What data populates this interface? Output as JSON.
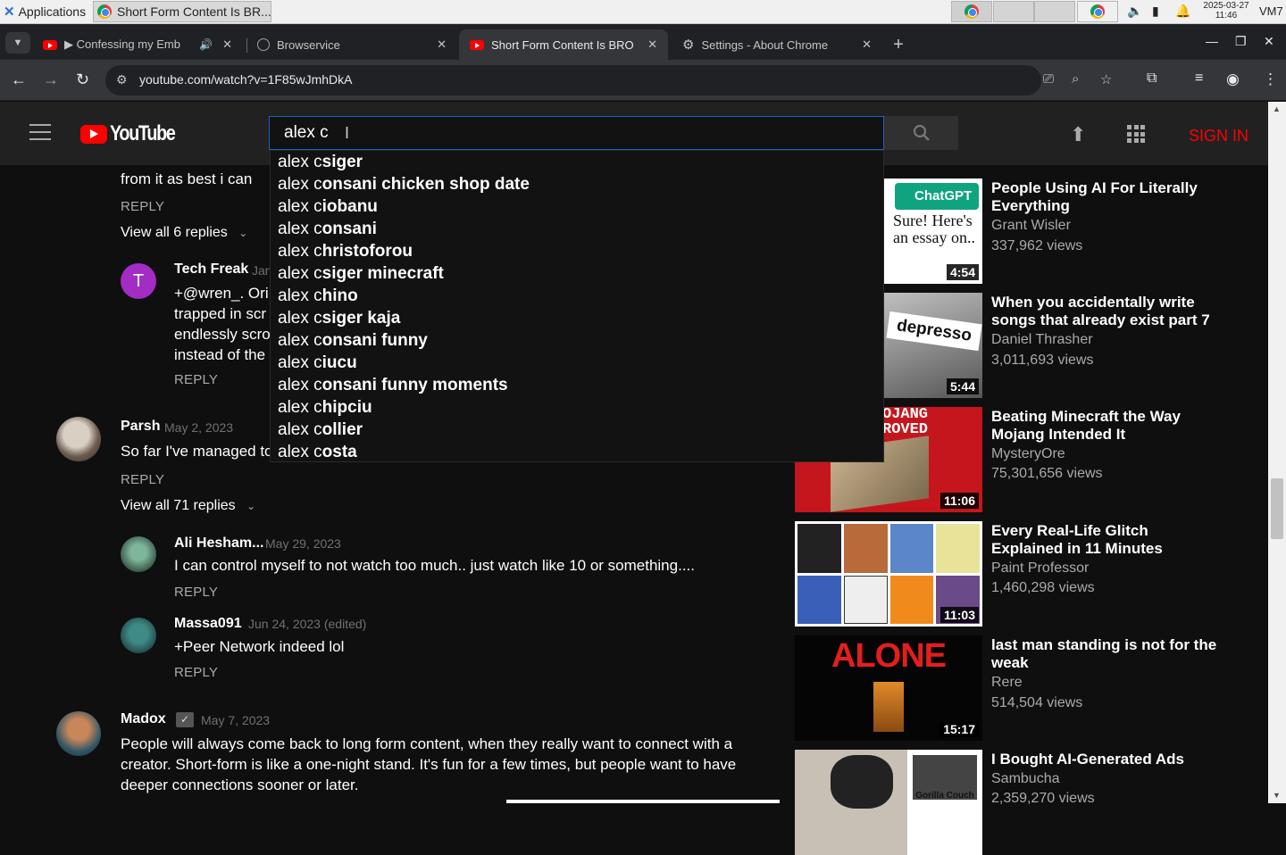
{
  "os": {
    "applications_label": "Applications",
    "task_title": "Short Form Content Is BR...",
    "clock_date": "2025-03-27",
    "clock_time": "11:46",
    "vm_label": "VM7"
  },
  "browser": {
    "tabs": [
      {
        "label": "▶ Confessing my Emba"
      },
      {
        "label": "Browservice"
      },
      {
        "label": "Short Form Content Is BRO"
      },
      {
        "label": "Settings - About Chrome"
      }
    ],
    "url": "youtube.com/watch?v=1F85wJmhDkA"
  },
  "youtube": {
    "logo_text": "YouTube",
    "search_value": "alex c",
    "sign_in": "SIGN IN",
    "suggestions": [
      {
        "prefix": "alex c",
        "rest": "siger"
      },
      {
        "prefix": "alex c",
        "rest": "onsani chicken shop date"
      },
      {
        "prefix": "alex c",
        "rest": "iobanu"
      },
      {
        "prefix": "alex c",
        "rest": "onsani"
      },
      {
        "prefix": "alex c",
        "rest": "hristoforou"
      },
      {
        "prefix": "alex c",
        "rest": "siger minecraft"
      },
      {
        "prefix": "alex c",
        "rest": "hino"
      },
      {
        "prefix": "alex c",
        "rest": "siger kaja"
      },
      {
        "prefix": "alex c",
        "rest": "onsani funny"
      },
      {
        "prefix": "alex c",
        "rest": "iucu"
      },
      {
        "prefix": "alex c",
        "rest": "onsani funny moments"
      },
      {
        "prefix": "alex c",
        "rest": "hipciu"
      },
      {
        "prefix": "alex c",
        "rest": "ollier"
      },
      {
        "prefix": "alex c",
        "rest": "osta"
      }
    ]
  },
  "comments": {
    "reply_label": "REPLY",
    "partial_line": "from it as best i can",
    "view_all_1": "View all 6 replies",
    "techfreak": {
      "initial": "T",
      "author": "Tech Freak",
      "date": "Jan",
      "lines": [
        "+@wren_. Ori",
        "trapped in scr",
        "endlessly scro",
        "instead of the"
      ]
    },
    "parsh": {
      "author": "Parsh",
      "date": "May 2, 2023",
      "text": "So far I've managed to"
    },
    "view_all_2": "View all 71 replies",
    "ali": {
      "author": "Ali Hesham...",
      "date": "May 29, 2023",
      "text": "I can control myself to not watch too much.. just watch like 10 or something...."
    },
    "massa": {
      "author": "Massa091",
      "date": "Jun 24, 2023 (edited)",
      "text": "+Peer Network indeed lol"
    },
    "madox": {
      "author": "Madox",
      "date": "May 7, 2023",
      "lines": [
        "People will always come back to long form content, when they really want to connect with a",
        "creator. Short-form is like a one-night stand. It's fun for a few times, but people want to have",
        "deeper connections sooner or later."
      ]
    }
  },
  "related": [
    {
      "title": "People Using AI For Literally Everything",
      "channel": "Grant Wisler",
      "views": "337,962 views",
      "duration": "4:54",
      "thumb_text": "Sure! Here's an essay on..",
      "thumb_badge": "ChatGPT"
    },
    {
      "title": "When you accidentally write songs that already exist part 7",
      "channel": "Daniel Thrasher",
      "views": "3,011,693 views",
      "duration": "5:44",
      "thumb_text": "depresso"
    },
    {
      "title": "Beating Minecraft the Way Mojang Intended It",
      "channel": "MysteryOre",
      "views": "75,301,656 views",
      "duration": "11:06",
      "thumb_text": "OJANG ROVED"
    },
    {
      "title": "Every Real-Life Glitch Explained in 11 Minutes",
      "channel": "Paint Professor",
      "views": "1,460,298 views",
      "duration": "11:03"
    },
    {
      "title": "last man standing is not for the weak",
      "channel": "Rere",
      "views": "514,504 views",
      "duration": "15:17",
      "thumb_text": "ALONE"
    },
    {
      "title": "I Bought AI-Generated Ads",
      "channel": "Sambucha",
      "views": "2,359,270 views",
      "thumb_text": "Gorilla Couch"
    }
  ],
  "colors": {
    "youtube_red": "#ff0000",
    "bg": "#0f0f0f",
    "header": "#212121"
  }
}
